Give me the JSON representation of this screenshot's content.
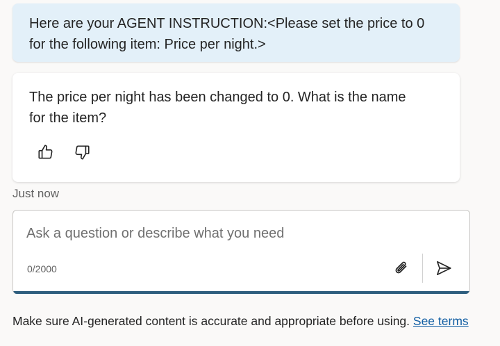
{
  "chat": {
    "user_message": {
      "line1": "Here are your AGENT INSTRUCTION:<Please set the price to 0",
      "line2": "for the following item: Price per night.>"
    },
    "bot_message": {
      "line1": "The price per night has been changed to 0. What is the name",
      "line2": "for the item?"
    },
    "feedback": {
      "like_icon": "thumbs-up-icon",
      "dislike_icon": "thumbs-down-icon"
    },
    "timestamp": "Just now"
  },
  "composer": {
    "placeholder": "Ask a question or describe what you need",
    "value": "",
    "char_count": "0/2000",
    "attach_icon": "paperclip-icon",
    "send_icon": "send-icon"
  },
  "footer": {
    "disclaimer": "Make sure AI-generated content is accurate and appropriate before using.",
    "link": "See terms"
  },
  "colors": {
    "user_bubble": "#e3f0f9",
    "bot_bubble": "#ffffff",
    "accent_underline": "#2e5e7e",
    "link": "#115ea3"
  }
}
